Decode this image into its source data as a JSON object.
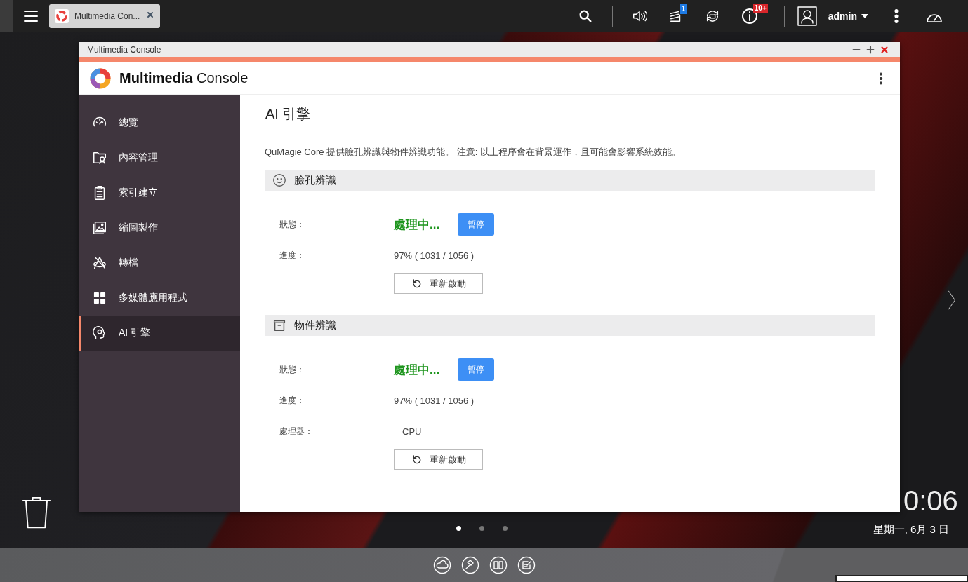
{
  "taskbar": {
    "tab": {
      "title": "Multimedia Con...",
      "selected": true
    },
    "notification_badge": "1",
    "info_badge": "10+",
    "user": "admin"
  },
  "window": {
    "title": "Multimedia Console",
    "app_name": "**Multimedia** Console",
    "sidebar": {
      "items": [
        {
          "label": "總覽",
          "selected": false
        },
        {
          "label": "內容管理",
          "selected": false
        },
        {
          "label": "索引建立",
          "selected": false
        },
        {
          "label": "縮圖製作",
          "selected": false
        },
        {
          "label": "轉檔",
          "selected": false
        },
        {
          "label": "多媒體應用程式",
          "selected": false
        },
        {
          "label": "AI 引擎",
          "selected": true
        }
      ]
    },
    "content": {
      "heading": "AI 引擎",
      "description": "QuMagie Core 提供臉孔辨識與物件辨識功能。 注意: 以上程序會在背景運作，且可能會影響系統效能。",
      "sections": [
        {
          "kind": "face",
          "title": "臉孔辨識",
          "status_label": "狀態：",
          "status": "處理中...",
          "pause_button": "暫停",
          "progress_label": "進度：",
          "progress": "97% ( 1031 / 1056 )",
          "restart_button": "重新啟動"
        },
        {
          "kind": "object",
          "title": "物件辨識",
          "status_label": "狀態：",
          "status": "處理中...",
          "pause_button": "暫停",
          "progress_label": "進度：",
          "progress": "97% ( 1031 / 1056 )",
          "processor_label": "處理器：",
          "processor": "CPU",
          "restart_button": "重新啟動"
        }
      ]
    }
  },
  "desktop": {
    "clock": "0:06",
    "date": "星期一, 6月 3 日",
    "page_dots": [
      {
        "selected": true
      },
      {
        "selected": false
      },
      {
        "selected": false
      }
    ]
  }
}
